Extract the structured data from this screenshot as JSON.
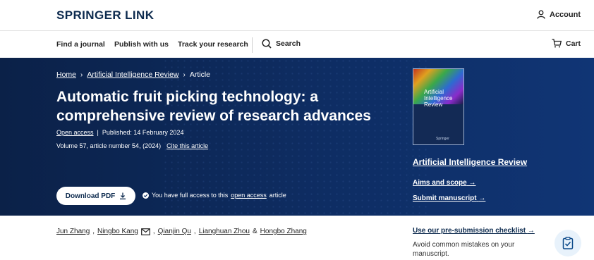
{
  "header": {
    "logo": "SPRINGER LINK",
    "account_label": "Account"
  },
  "nav": {
    "items": [
      "Find a journal",
      "Publish with us",
      "Track your research"
    ],
    "search_label": "Search",
    "cart_label": "Cart"
  },
  "breadcrumb": {
    "home": "Home",
    "journal": "Artificial Intelligence Review",
    "current": "Article"
  },
  "article": {
    "title": "Automatic fruit picking technology: a comprehensive review of research advances",
    "open_access": "Open access",
    "published": "Published: 14 February 2024",
    "volume": "Volume 57, article number 54, (2024)",
    "cite": "Cite this article",
    "download_label": "Download PDF",
    "access_prefix": "You have full access to this",
    "access_link": "open access",
    "access_suffix": "article"
  },
  "cover": {
    "title": "Artificial Intelligence Review",
    "publisher": "Springer"
  },
  "journal_panel": {
    "journal_name": "Artificial Intelligence Review",
    "aims": "Aims and scope",
    "submit": "Submit manuscript"
  },
  "authors": {
    "list": [
      "Jun Zhang",
      "Ningbo Kang",
      "Qianjin Qu",
      "Lianghuan Zhou",
      "Hongbo Zhang"
    ]
  },
  "sidebar": {
    "checklist": "Use our pre-submission checklist",
    "avoid": "Avoid common mistakes on your manuscript."
  },
  "colors": {
    "hero_bg": "#0e2d63",
    "brand": "#0c2a4e",
    "fab_bg": "#e8f2fb"
  }
}
